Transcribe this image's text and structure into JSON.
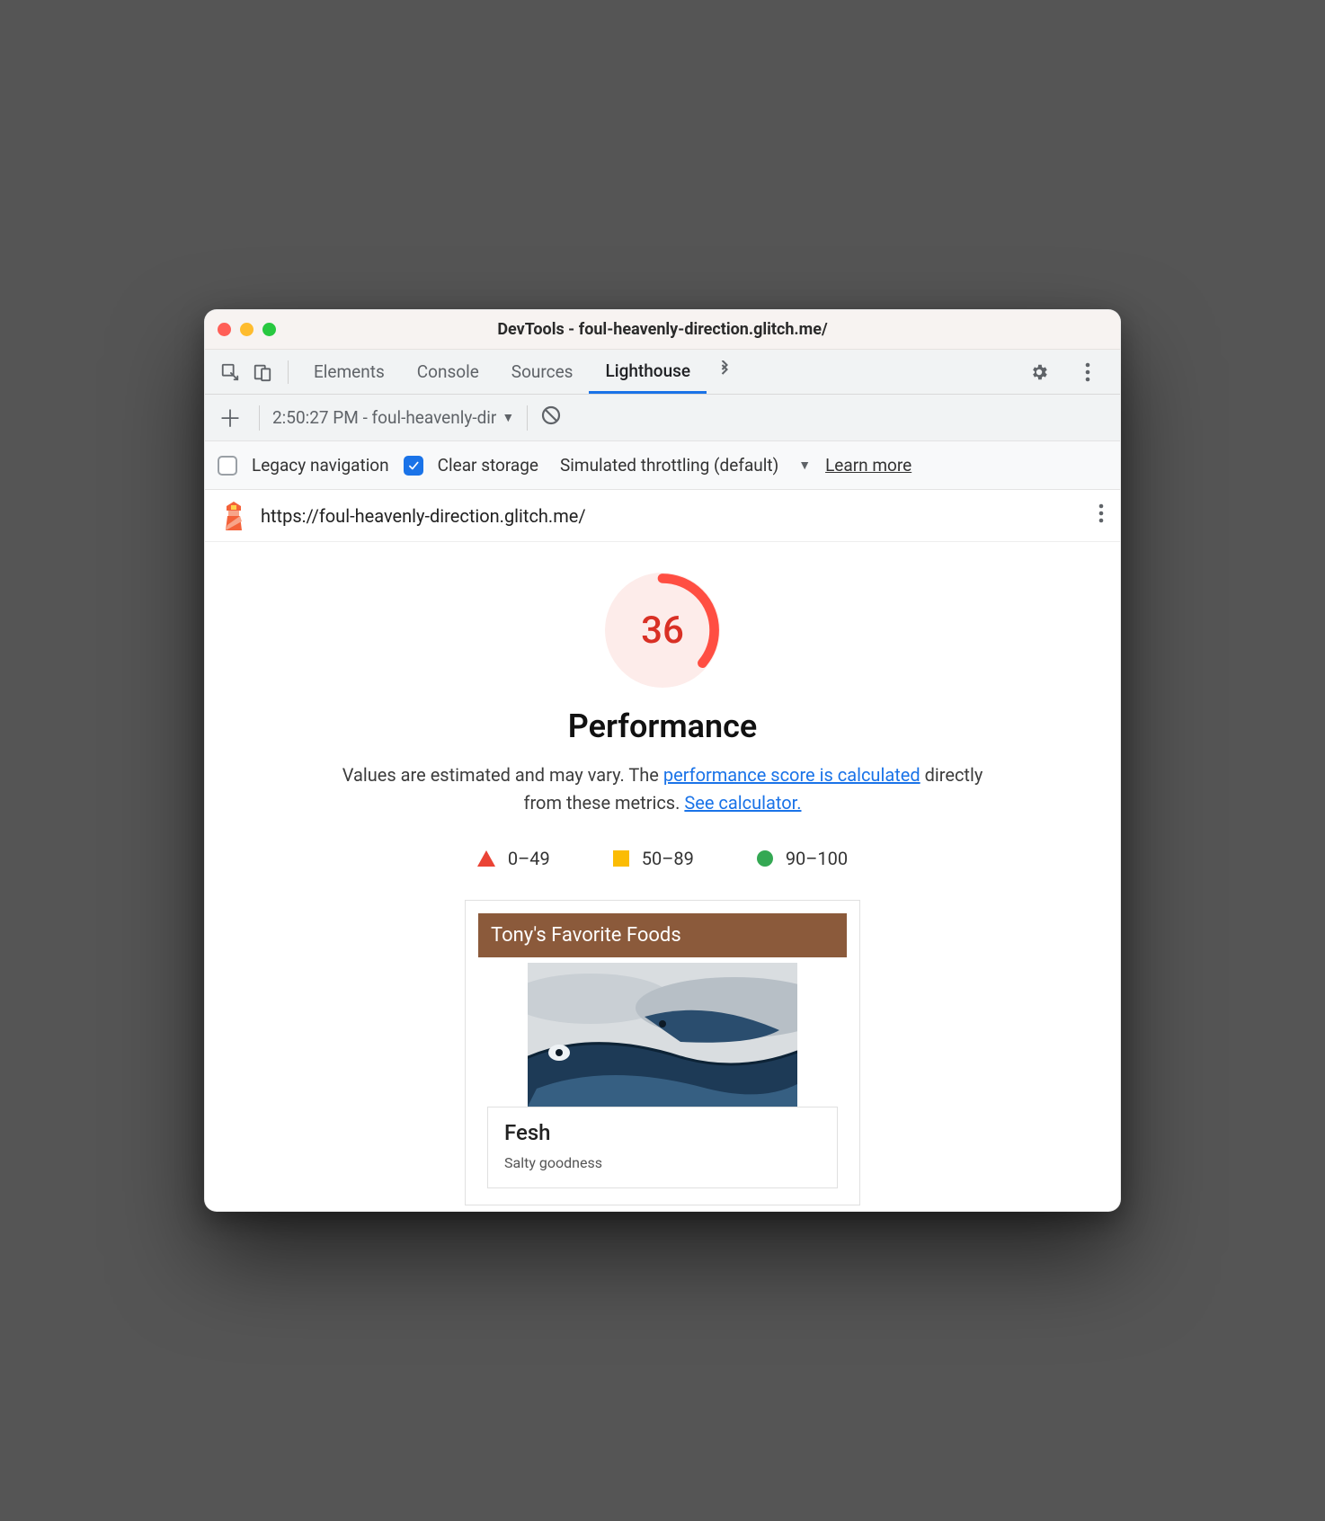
{
  "window": {
    "title": "DevTools - foul-heavenly-direction.glitch.me/"
  },
  "tabs": {
    "elements": "Elements",
    "console": "Console",
    "sources": "Sources",
    "lighthouse": "Lighthouse"
  },
  "lighthouse_toolbar": {
    "selected_report": "2:50:27 PM - foul-heavenly-dir",
    "legacy_nav_label": "Legacy navigation",
    "clear_storage_label": "Clear storage",
    "throttling_label": "Simulated throttling (default)",
    "learn_more": "Learn more",
    "url": "https://foul-heavenly-direction.glitch.me/"
  },
  "report": {
    "score": "36",
    "category_title": "Performance",
    "description_pre": "Values are estimated and may vary. The ",
    "description_link1": "performance score is calculated",
    "description_mid": " directly from these metrics. ",
    "description_link2": "See calculator.",
    "legend": {
      "low": "0–49",
      "mid": "50–89",
      "high": "90–100"
    },
    "filmstrip": {
      "header": "Tony's Favorite Foods",
      "card_title": "Fesh",
      "card_sub": "Salty goodness"
    }
  },
  "colors": {
    "fail": "#d93025",
    "avg": "#fbbc04",
    "pass": "#34a853",
    "link": "#1a73e8"
  }
}
